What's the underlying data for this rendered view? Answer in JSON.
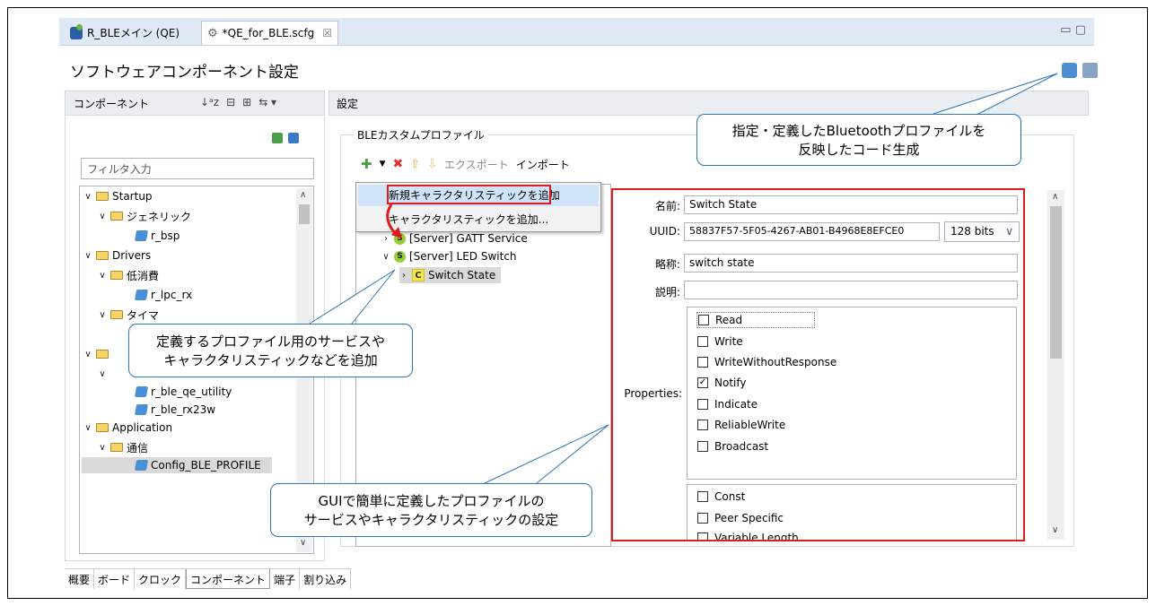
{
  "tabs": [
    {
      "label": "R_BLEメイン (QE)"
    },
    {
      "label": "*QE_for_BLE.scfg",
      "close": "☒"
    }
  ],
  "window_controls": "▭ ▢",
  "title": "ソフトウェアコンポーネント設定",
  "left_panel": {
    "header": "コンポーネント",
    "filter_placeholder": "フィルタ入力",
    "tree": [
      {
        "label": "Startup",
        "type": "folder",
        "level": 0
      },
      {
        "label": "ジェネリック",
        "type": "folder",
        "level": 1
      },
      {
        "label": "r_bsp",
        "type": "component",
        "level": 2
      },
      {
        "label": "Drivers",
        "type": "folder",
        "level": 0
      },
      {
        "label": "低消費",
        "type": "folder",
        "level": 1
      },
      {
        "label": "r_lpc_rx",
        "type": "component",
        "level": 2
      },
      {
        "label": "タイマ",
        "type": "folder",
        "level": 1
      },
      {
        "label": "r_ble_qe_utility",
        "type": "component",
        "level": 2
      },
      {
        "label": "r_ble_rx23w",
        "type": "component",
        "level": 2
      },
      {
        "label": "Application",
        "type": "folder",
        "level": 0
      },
      {
        "label": "通信",
        "type": "folder",
        "level": 1
      },
      {
        "label": "Config_BLE_PROFILE",
        "type": "component",
        "level": 2,
        "selected": true
      }
    ]
  },
  "bottom_tabs": [
    "概要",
    "ボード",
    "クロック",
    "コンポーネント",
    "端子",
    "割り込み"
  ],
  "right_panel": {
    "header": "設定",
    "group_title": "BLEカスタムプロファイル",
    "toolbar": {
      "export": "エクスポート",
      "import": "インポート"
    },
    "menu": [
      "新規キャラクタリスティックを追加",
      "キャラクタリスティックを追加..."
    ],
    "tree": [
      {
        "label": "[Server] GATT Service",
        "badge": "S"
      },
      {
        "label": "[Server] LED Switch",
        "badge": "S"
      },
      {
        "label": "Switch State",
        "badge": "C"
      }
    ],
    "fields": {
      "name_label": "名前:",
      "name_value": "Switch State",
      "uuid_label": "UUID:",
      "uuid_value": "58837F57-5F05-4267-AB01-B4968E8EFCE0",
      "uuid_bits": "128 bits",
      "abbr_label": "略称:",
      "abbr_value": "switch state",
      "desc_label": "説明:",
      "desc_value": "",
      "properties_label": "Properties:"
    },
    "properties": [
      {
        "label": "Read",
        "checked": false
      },
      {
        "label": "Write",
        "checked": false
      },
      {
        "label": "WriteWithoutResponse",
        "checked": false
      },
      {
        "label": "Notify",
        "checked": true
      },
      {
        "label": "Indicate",
        "checked": false
      },
      {
        "label": "ReliableWrite",
        "checked": false
      },
      {
        "label": "Broadcast",
        "checked": false
      }
    ],
    "aux_properties": [
      {
        "label": "Const",
        "checked": false
      },
      {
        "label": "Peer Specific",
        "checked": false
      },
      {
        "label": "Variable Length",
        "checked": false
      }
    ]
  },
  "callouts": {
    "code_gen": [
      "指定・定義したBluetoothプロファイルを",
      "反映したコード生成"
    ],
    "add_service": [
      "定義するプロファイル用のサービスや",
      "キャラクタリスティックなどを追加"
    ],
    "gui_define": [
      "GUIで簡単に定義したプロファイルの",
      "サービスやキャラクタリスティックの設定"
    ]
  },
  "colors": {
    "highlight": "#e01b1b",
    "callout_border": "#2e75b6",
    "tab_bar": "#dfe9f5"
  }
}
